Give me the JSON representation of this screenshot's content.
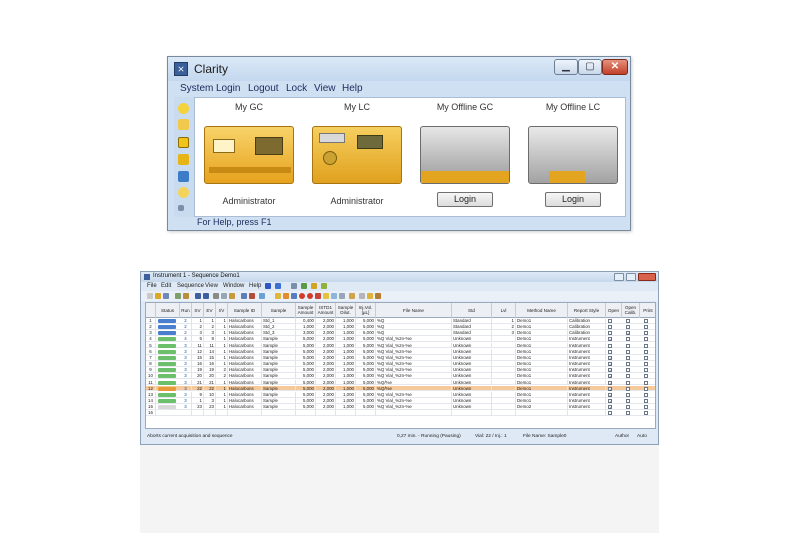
{
  "colors": {
    "window_frame": "#cfe0f2",
    "accent": "#1c2f60",
    "instrument": "#e9a822",
    "highlight_row": "#f6c99b"
  },
  "clarity": {
    "title": "Clarity",
    "menu": [
      "System",
      "Login",
      "Logout",
      "Lock",
      "View",
      "Help"
    ],
    "instruments": [
      {
        "name": "My GC",
        "user": "Administrator",
        "icon": "gc-instrument-icon"
      },
      {
        "name": "My LC",
        "user": "Administrator",
        "icon": "lc-instrument-icon"
      },
      {
        "name": "My Offline GC",
        "login": "Login",
        "icon": "offline-gc-icon"
      },
      {
        "name": "My Offline LC",
        "login": "Login",
        "icon": "offline-lc-icon"
      }
    ],
    "status": "For Help, press F1"
  },
  "sequence": {
    "title": "Instrument 1 - Sequence Demo1",
    "menu": [
      "File",
      "Edit",
      "Sequence",
      "View",
      "Window",
      "Help"
    ],
    "columns": [
      "Status",
      "Run",
      "SV",
      "EV",
      "I/V",
      "Sample ID",
      "Sample",
      "Sample Amount",
      "ISTD1 Amount",
      "Sample Dilut.",
      "Inj.Vol. [µL]",
      "File Name",
      "Std",
      "Lvl",
      "Method Name",
      "Report Style",
      "Open",
      "Open Calib.",
      "Print"
    ],
    "rows": [
      [
        "1",
        "2",
        "1",
        "1",
        "1",
        "Halocarbons",
        "Std_1",
        "0,400",
        "2,000",
        "1,000",
        "5,000",
        "%Q",
        "Standard",
        "1",
        "Demo1",
        "Calibration"
      ],
      [
        "2",
        "2",
        "2",
        "2",
        "1",
        "Halocarbons",
        "Std_2",
        "1,000",
        "2,000",
        "1,000",
        "5,000",
        "%Q",
        "Standard",
        "2",
        "Demo1",
        "Calibration"
      ],
      [
        "3",
        "2",
        "3",
        "3",
        "1",
        "Halocarbons",
        "Std_3",
        "3,000",
        "2,000",
        "1,000",
        "5,000",
        "%Q",
        "Standard",
        "3",
        "Demo1",
        "Calibration"
      ],
      [
        "4",
        "4",
        "5",
        "8",
        "1",
        "Halocarbons",
        "Sample",
        "5,000",
        "2,000",
        "1,000",
        "5,000",
        "%Q Vial_%2n-%e",
        "Unknown",
        "",
        "Demo1",
        "Instrument"
      ],
      [
        "5",
        "3",
        "11",
        "11",
        "1",
        "Halocarbons",
        "Sample",
        "5,000",
        "2,000",
        "1,000",
        "5,000",
        "%Q Vial_%2n-%e",
        "Unknown",
        "",
        "Demo1",
        "Instrument"
      ],
      [
        "6",
        "3",
        "12",
        "14",
        "1",
        "Halocarbons",
        "Sample",
        "5,000",
        "2,000",
        "1,000",
        "5,000",
        "%Q Vial_%2n-%e",
        "Unknown",
        "",
        "Demo1",
        "Instrument"
      ],
      [
        "7",
        "3",
        "15",
        "15",
        "1",
        "Halocarbons",
        "Sample",
        "5,000",
        "2,000",
        "1,000",
        "5,000",
        "%Q Vial_%2n-%e",
        "Unknown",
        "",
        "Demo1",
        "Instrument"
      ],
      [
        "8",
        "3",
        "16",
        "16",
        "1",
        "Halocarbons",
        "Sample",
        "5,000",
        "2,000",
        "1,000",
        "5,000",
        "%Q Vial_%2n-%e",
        "Unknown",
        "",
        "Demo1",
        "Instrument"
      ],
      [
        "9",
        "3",
        "19",
        "19",
        "2",
        "Halocarbons",
        "Sample",
        "5,000",
        "2,000",
        "1,000",
        "5,000",
        "%Q Vial_%2n-%e",
        "Unknown",
        "",
        "Demo1",
        "Instrument"
      ],
      [
        "10",
        "3",
        "20",
        "20",
        "2",
        "Halocarbons",
        "Sample",
        "5,000",
        "2,000",
        "1,000",
        "5,000",
        "%Q Vial_%2n-%e",
        "Unknown",
        "",
        "Demo1",
        "Instrument"
      ],
      [
        "11",
        "3",
        "21",
        "21",
        "1",
        "Halocarbons",
        "Sample",
        "5,000",
        "2,000",
        "1,000",
        "5,000",
        "%Q/%e",
        "Unknown",
        "",
        "Demo1",
        "Instrument"
      ],
      [
        "12",
        "3",
        "22",
        "22",
        "1",
        "Halocarbons",
        "Sample",
        "5,000",
        "2,000",
        "1,000",
        "5,000",
        "%Q/%e",
        "Unknown",
        "",
        "Demo1",
        "Instrument"
      ],
      [
        "13",
        "3",
        "9",
        "10",
        "1",
        "Halocarbons",
        "Sample",
        "5,000",
        "2,000",
        "1,000",
        "5,000",
        "%Q Vial_%2n-%e",
        "Unknown",
        "",
        "Demo1",
        "Instrument"
      ],
      [
        "14",
        "3",
        "1",
        "3",
        "1",
        "Halocarbons",
        "Sample",
        "5,000",
        "2,000",
        "1,000",
        "5,000",
        "%Q Vial_%2n-%e",
        "Unknown",
        "",
        "Demo1",
        "Instrument"
      ],
      [
        "15",
        "3",
        "23",
        "23",
        "1",
        "Halocarbons",
        "Sample",
        "5,000",
        "2,000",
        "1,000",
        "5,000",
        "%Q Vial_%2n-%e",
        "Unknown",
        "",
        "Demo2",
        "Instrument"
      ],
      [
        "16",
        "",
        "",
        "",
        "",
        "",
        "",
        "",
        "",
        "",
        "",
        "",
        "",
        "",
        "",
        ""
      ]
    ],
    "status": [
      "Aborts current acquisition and sequence",
      "0,27 min. - Running (Pausing)",
      "Vial: 22 / Inj.: 1",
      "File Name: Sample0",
      "Author",
      "Auto"
    ]
  }
}
